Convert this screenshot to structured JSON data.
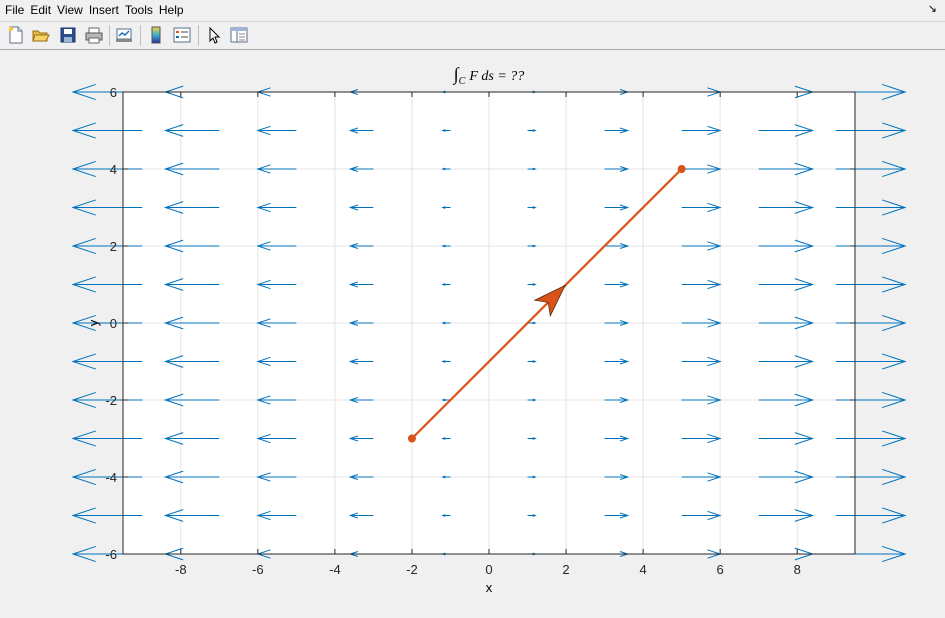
{
  "menu": {
    "items": [
      "File",
      "Edit",
      "View",
      "Insert",
      "Tools",
      "Help"
    ],
    "dock_glyph": "↘"
  },
  "toolbar": {
    "buttons": [
      "new-figure-icon",
      "open-file-icon",
      "save-icon",
      "print-icon",
      "link-plot-icon",
      "insert-colorbar-icon",
      "insert-legend-icon",
      "pointer-icon",
      "property-inspector-icon"
    ]
  },
  "chart_data": {
    "type": "quiver",
    "title": "∫C F ds = ??",
    "title_parts": {
      "integral": "∫",
      "subscript": "C",
      "body": "F  ds = ??"
    },
    "xlabel": "x",
    "ylabel": "y",
    "xlim": [
      -9.5,
      9.5
    ],
    "ylim": [
      -6,
      6
    ],
    "xticks": [
      -8,
      -6,
      -4,
      -2,
      0,
      2,
      4,
      6,
      8
    ],
    "yticks": [
      -6,
      -4,
      -2,
      0,
      2,
      4,
      6
    ],
    "grid": true,
    "colors": {
      "vector_field": "#0072bd",
      "curve": "#d95319",
      "axes_bg": "#ffffff"
    },
    "vector_field": {
      "formula": "F(x,y) = (x, 0)",
      "x": [
        -9,
        -7,
        -5,
        -3,
        -1,
        1,
        3,
        5,
        7,
        9
      ],
      "y": [
        -6,
        -5,
        -4,
        -3,
        -2,
        -1,
        0,
        1,
        2,
        3,
        4,
        5,
        6
      ]
    },
    "curve": {
      "start": [
        -2,
        -3
      ],
      "end": [
        5,
        4
      ],
      "arrow_at": [
        1.5,
        0.5
      ]
    }
  }
}
